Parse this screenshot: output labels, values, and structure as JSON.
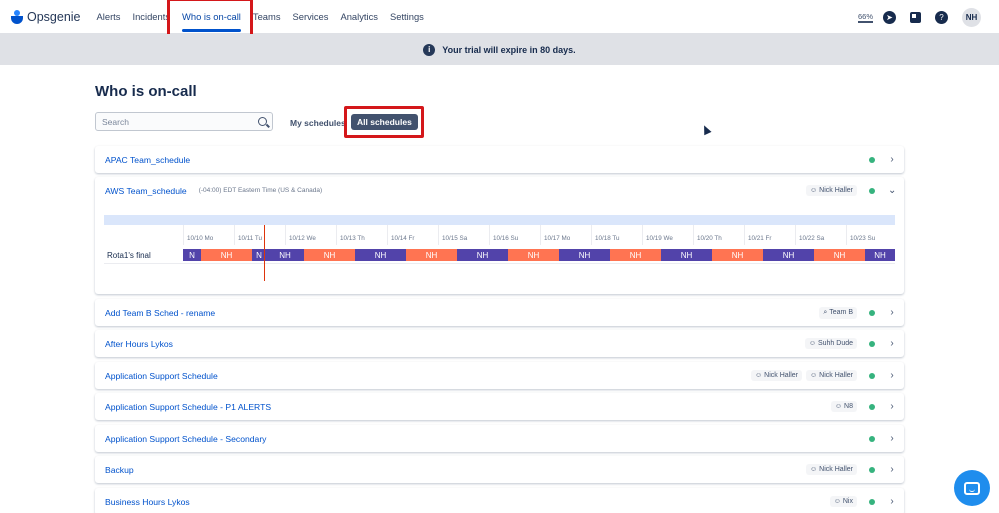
{
  "nav": {
    "logo_text": "Opsgenie",
    "items": [
      {
        "label": "Alerts",
        "active": false
      },
      {
        "label": "Incidents",
        "active": false
      },
      {
        "label": "Who is on-call",
        "active": true
      },
      {
        "label": "Teams",
        "active": false
      },
      {
        "label": "Services",
        "active": false
      },
      {
        "label": "Analytics",
        "active": false
      },
      {
        "label": "Settings",
        "active": false
      }
    ],
    "zoom": "66%",
    "avatar_initials": "NH",
    "help_glyph": "?"
  },
  "banner": {
    "info_glyph": "i",
    "text": "Your trial will expire in 80 days."
  },
  "page": {
    "title": "Who is on-call",
    "search_placeholder": "Search",
    "toggle_my": "My schedules",
    "toggle_all": "All schedules"
  },
  "schedules": [
    {
      "name": "APAC Team_schedule",
      "chips": [],
      "expanded": false
    },
    {
      "name": "AWS Team_schedule",
      "timezone": "(-04:00) EDT Eastern Time (US & Canada)",
      "chips": [
        {
          "glyph": "☺",
          "text": "Nick Haller"
        }
      ],
      "expanded": true
    },
    {
      "name": "Add Team B Sched - rename",
      "chips": [
        {
          "glyph": "⌕",
          "text": "Team B"
        }
      ],
      "expanded": false
    },
    {
      "name": "After Hours Lykos",
      "chips": [
        {
          "glyph": "☺",
          "text": "Suhh Dude"
        }
      ],
      "expanded": false
    },
    {
      "name": "Application Support Schedule",
      "chips": [
        {
          "glyph": "☺",
          "text": "Nick Haller"
        },
        {
          "glyph": "☺",
          "text": "Nick Haller"
        }
      ],
      "expanded": false
    },
    {
      "name": "Application Support Schedule - P1 ALERTS",
      "chips": [
        {
          "glyph": "☺",
          "text": "N8"
        }
      ],
      "expanded": false
    },
    {
      "name": "Application Support Schedule - Secondary",
      "chips": [],
      "expanded": false
    },
    {
      "name": "Backup",
      "chips": [
        {
          "glyph": "☺",
          "text": "Nick Haller"
        }
      ],
      "expanded": false
    },
    {
      "name": "Business Hours Lykos",
      "chips": [
        {
          "glyph": "☺",
          "text": "Nix"
        }
      ],
      "expanded": false
    }
  ],
  "timeline": {
    "rotation_label": "Rota1's final",
    "dates": [
      "10/10 Mo",
      "10/11 Tu",
      "10/12 We",
      "10/13 Th",
      "10/14 Fr",
      "10/15 Sa",
      "10/16 Su",
      "10/17 Mo",
      "10/18 Tu",
      "10/19 We",
      "10/20 Th",
      "10/21 Fr",
      "10/22 Sa",
      "10/23 Su"
    ],
    "segments": [
      {
        "text": "N",
        "color": "purple"
      },
      {
        "text": "NH",
        "color": "orange"
      },
      {
        "text": "N",
        "color": "purple"
      },
      {
        "text": "NH",
        "color": "purple"
      },
      {
        "text": "NH",
        "color": "orange"
      },
      {
        "text": "NH",
        "color": "purple"
      },
      {
        "text": "NH",
        "color": "orange"
      },
      {
        "text": "NH",
        "color": "purple"
      },
      {
        "text": "NH",
        "color": "orange"
      },
      {
        "text": "NH",
        "color": "purple"
      },
      {
        "text": "NH",
        "color": "orange"
      },
      {
        "text": "NH",
        "color": "purple"
      },
      {
        "text": "NH",
        "color": "orange"
      },
      {
        "text": "NH",
        "color": "purple"
      },
      {
        "text": "NH",
        "color": "orange"
      },
      {
        "text": "NH",
        "color": "purple"
      }
    ]
  },
  "colors": {
    "accent": "#0052cc",
    "highlight": "#d4171a",
    "on_call_dot": "#36b37e",
    "rota_purple": "#5243aa",
    "rota_orange": "#ff7452"
  },
  "icons": [
    "info-icon",
    "search-icon",
    "chevron-right-icon",
    "chevron-down-icon",
    "user-icon",
    "team-icon",
    "compass-icon",
    "app-switcher-icon",
    "help-icon",
    "chat-icon"
  ]
}
